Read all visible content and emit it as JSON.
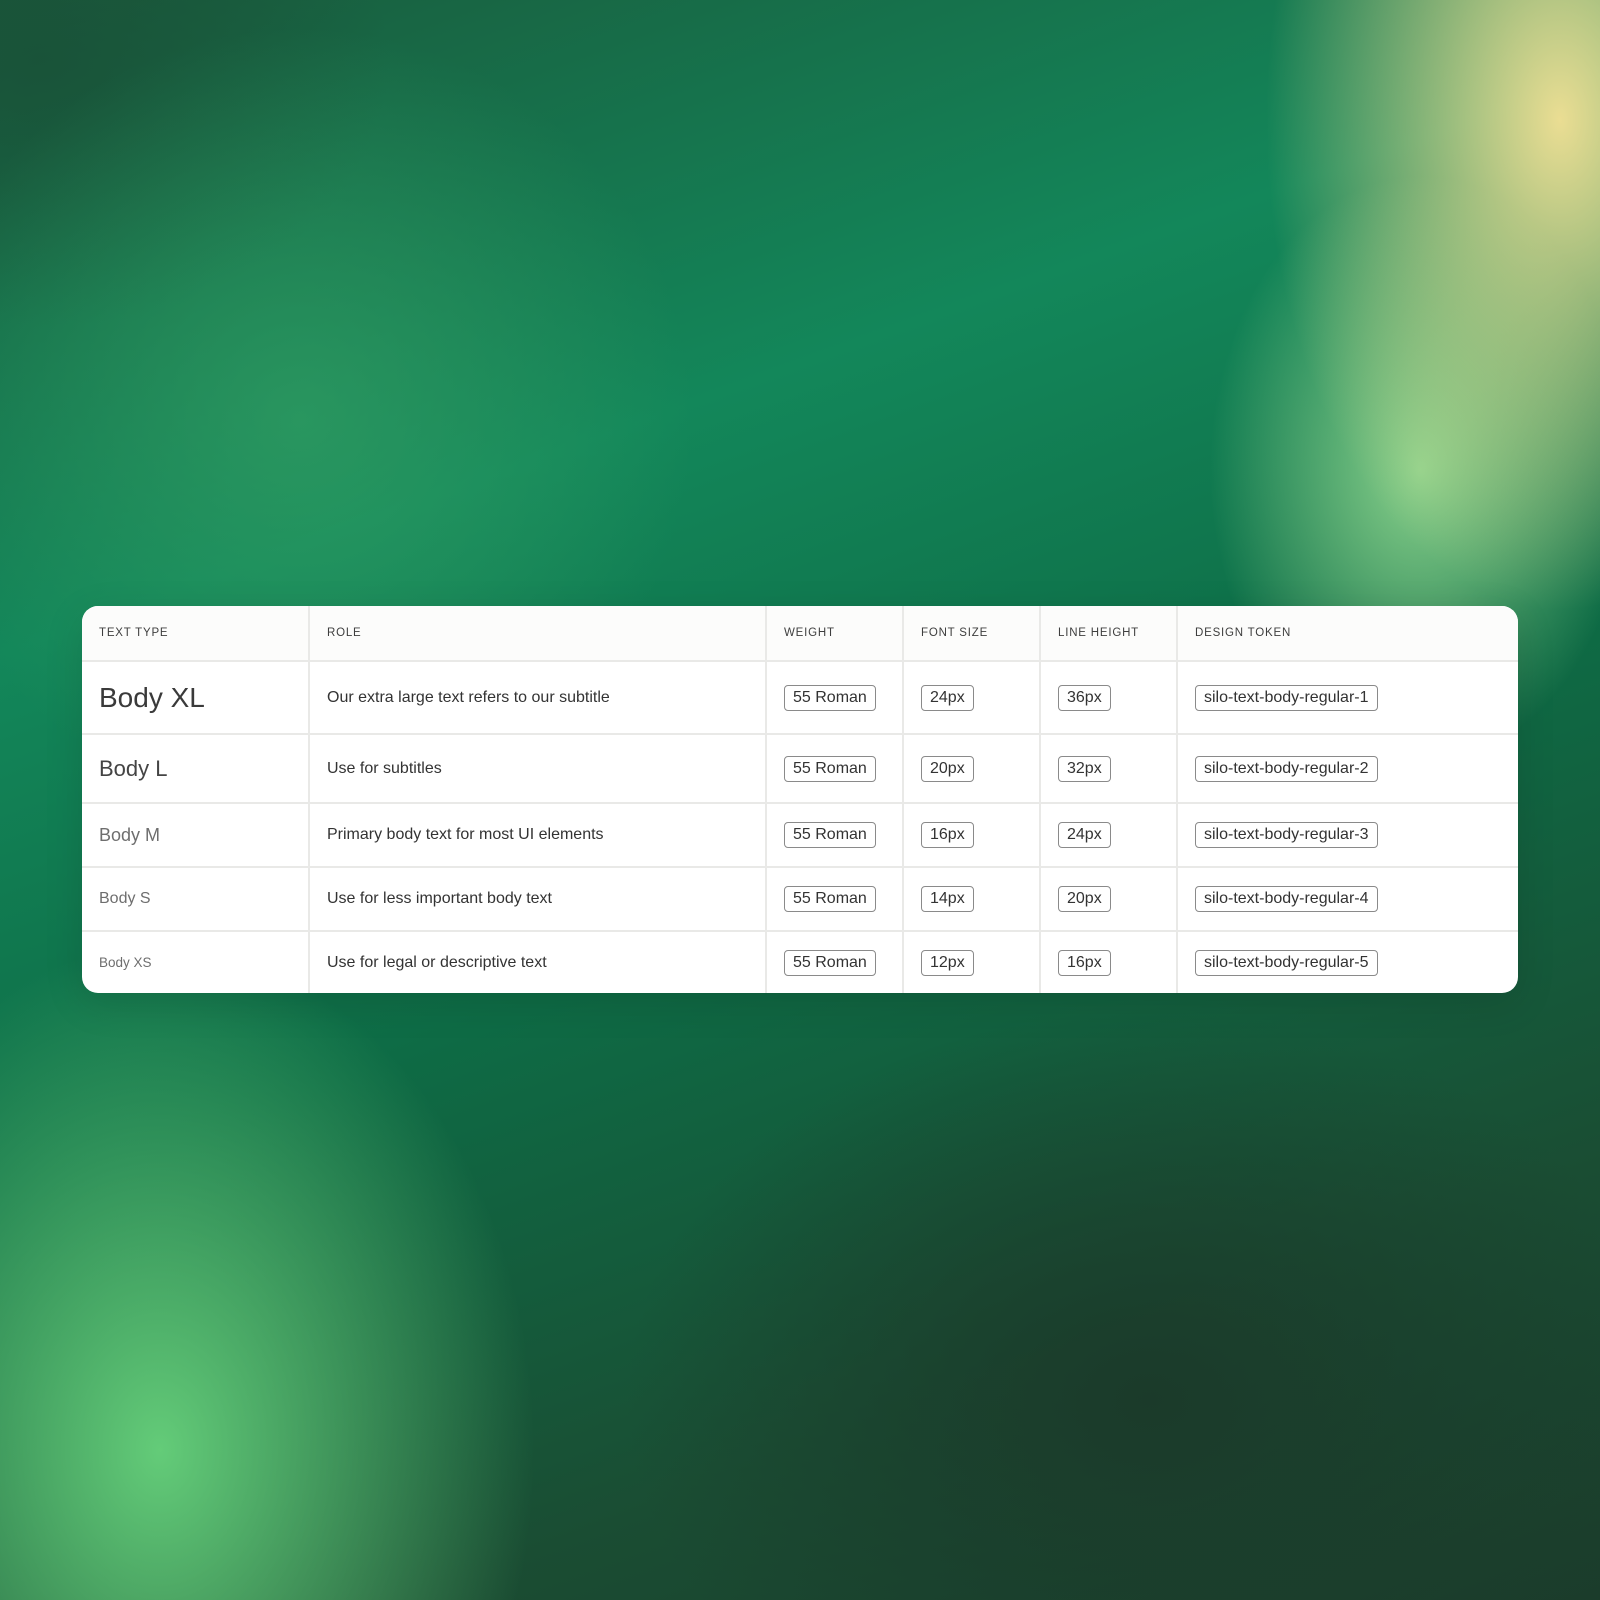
{
  "headers": {
    "text_type": "TEXT TYPE",
    "role": "ROLE",
    "weight": "WEIGHT",
    "font_size": "FONT SIZE",
    "line_height": "LINE HEIGHT",
    "design_token": "DESIGN TOKEN"
  },
  "rows": [
    {
      "text_type": "Body XL",
      "role": "Our extra large text refers to our subtitle",
      "weight": "55 Roman",
      "font_size": "24px",
      "line_height": "36px",
      "design_token": "silo-text-body-regular-1"
    },
    {
      "text_type": "Body L",
      "role": "Use for subtitles",
      "weight": "55 Roman",
      "font_size": "20px",
      "line_height": "32px",
      "design_token": "silo-text-body-regular-2"
    },
    {
      "text_type": "Body M",
      "role": "Primary body text for most UI elements",
      "weight": "55 Roman",
      "font_size": "16px",
      "line_height": "24px",
      "design_token": "silo-text-body-regular-3"
    },
    {
      "text_type": "Body S",
      "role": "Use for less important body text",
      "weight": "55 Roman",
      "font_size": "14px",
      "line_height": "20px",
      "design_token": "silo-text-body-regular-4"
    },
    {
      "text_type": "Body XS",
      "role": "Use for legal or descriptive text",
      "weight": "55 Roman",
      "font_size": "12px",
      "line_height": "16px",
      "design_token": "silo-text-body-regular-5"
    }
  ]
}
